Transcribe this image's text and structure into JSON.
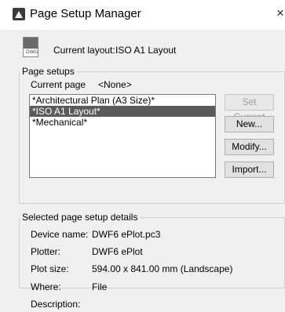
{
  "window": {
    "title": "Page Setup Manager",
    "close_glyph": "×"
  },
  "header": {
    "icon_label": "DWG",
    "current_layout_label": "Current layout:",
    "current_layout_value": "ISO A1 Layout"
  },
  "page_setups": {
    "legend": "Page setups",
    "current_page_label": "Current page",
    "current_page_value": "<None>",
    "items": [
      {
        "label": "*Architectural Plan (A3 Size)*",
        "selected": false
      },
      {
        "label": "*ISO A1 Layout*",
        "selected": true
      },
      {
        "label": "*Mechanical*",
        "selected": false
      }
    ],
    "buttons": {
      "set_current": "Set Current",
      "new": "New...",
      "modify": "Modify...",
      "import": "Import..."
    }
  },
  "details": {
    "legend": "Selected page setup details",
    "device_name_label": "Device name:",
    "device_name_value": "DWF6 ePlot.pc3",
    "plotter_label": "Plotter:",
    "plotter_value": "DWF6 ePlot",
    "plot_size_label": "Plot size:",
    "plot_size_value": "594.00 x 841.00 mm (Landscape)",
    "where_label": "Where:",
    "where_value": "File",
    "description_label": "Description:"
  }
}
